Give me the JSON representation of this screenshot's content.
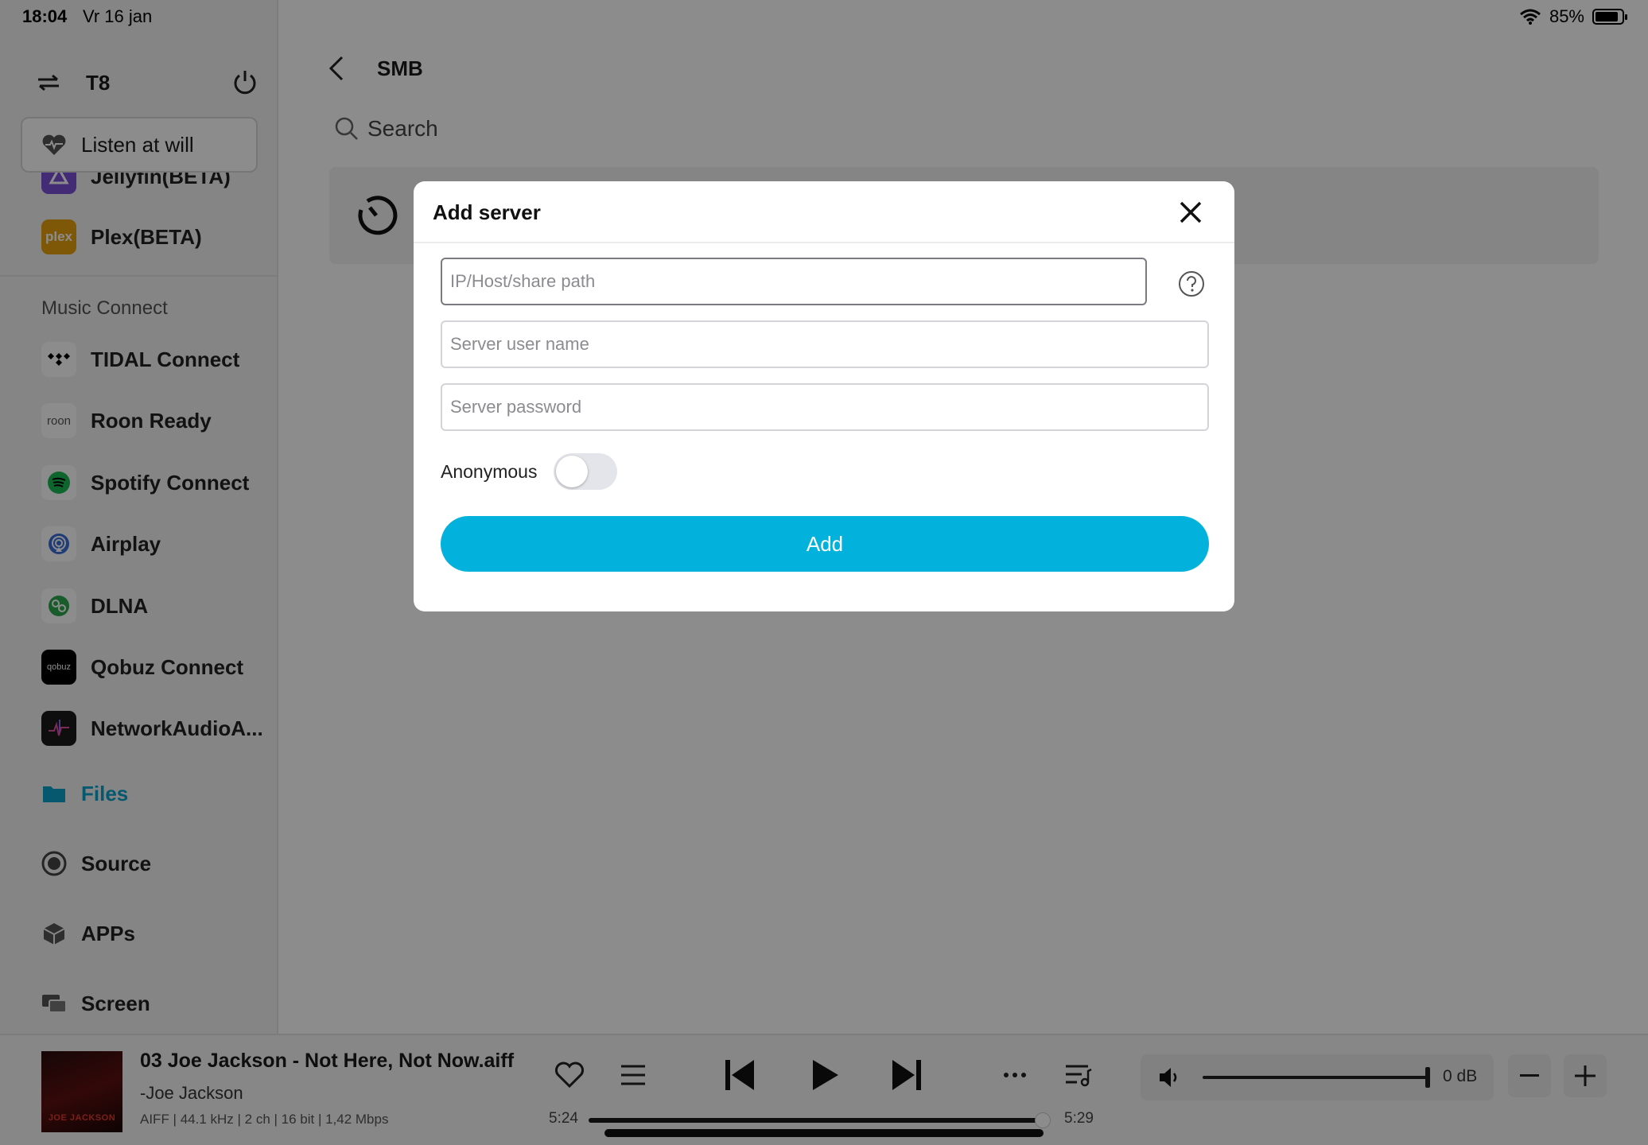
{
  "status_bar": {
    "time": "18:04",
    "date": "Vr 16 jan",
    "battery": "85%"
  },
  "sidebar": {
    "device": "T8",
    "listen_at_will": "Listen at will",
    "sources": [
      {
        "label": "Jellyfin(BETA)",
        "icon": "jellyfin-icon",
        "color": "#7b4fd6"
      },
      {
        "label": "Plex(BETA)",
        "icon": "plex-icon",
        "color": "#e5a00d"
      }
    ],
    "music_connect_heading": "Music Connect",
    "connect_items": [
      {
        "label": "TIDAL Connect",
        "icon": "tidal-icon"
      },
      {
        "label": "Roon Ready",
        "icon": "roon-icon"
      },
      {
        "label": "Spotify Connect",
        "icon": "spotify-icon"
      },
      {
        "label": "Airplay",
        "icon": "airplay-icon"
      },
      {
        "label": "DLNA",
        "icon": "dlna-icon"
      },
      {
        "label": "Qobuz Connect",
        "icon": "qobuz-icon"
      },
      {
        "label": "NetworkAudioA...",
        "icon": "network-audio-icon"
      }
    ],
    "nav": {
      "files": "Files",
      "source": "Source",
      "apps": "APPs",
      "screen": "Screen"
    },
    "accent": "#0aa0c8"
  },
  "main": {
    "title": "SMB",
    "search_placeholder": "Search"
  },
  "modal": {
    "title": "Add server",
    "host_placeholder": "IP/Host/share path",
    "username_placeholder": "Server user name",
    "password_placeholder": "Server password",
    "anonymous_label": "Anonymous",
    "anonymous_on": false,
    "add_label": "Add",
    "add_color": "#02b2dc"
  },
  "player": {
    "album_text": "JOE JACKSON",
    "track_title": "03 Joe Jackson - Not Here, Not Now.aiff",
    "artist": "-Joe Jackson",
    "meta": "AIFF | 44.1 kHz | 2 ch | 16 bit | 1,42 Mbps",
    "elapsed": "5:24",
    "duration": "5:29",
    "progress": 0.985,
    "volume_db": "0 dB",
    "volume_level": 1.0
  }
}
